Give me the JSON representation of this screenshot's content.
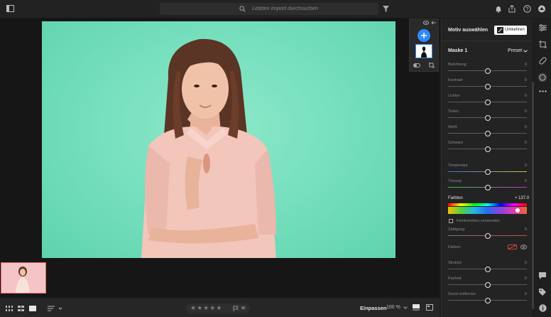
{
  "search": {
    "placeholder": "Letzten Import durchsuchen"
  },
  "rating": {
    "stars": 0,
    "max": 5
  },
  "bottom": {
    "fit_label": "Einpassen",
    "zoom_label": "100 %"
  },
  "panel": {
    "motif_label": "Motiv auswählen",
    "invert_label": "Umkehren",
    "mask_title": "Maske 1",
    "preset_label": "Preset",
    "sliders_top": [
      {
        "label": "Belichtung",
        "value": "0",
        "pos": 0.5
      },
      {
        "label": "Kontrast",
        "value": "0",
        "pos": 0.5
      },
      {
        "label": "Lichter",
        "value": "0",
        "pos": 0.5
      },
      {
        "label": "Tiefen",
        "value": "0",
        "pos": 0.5
      },
      {
        "label": "Weiß",
        "value": "0",
        "pos": 0.5
      },
      {
        "label": "Schwarz",
        "value": "0",
        "pos": 0.5
      }
    ],
    "sliders_color": [
      {
        "label": "Temperatur",
        "value": "0",
        "pos": 0.5
      },
      {
        "label": "Tönung",
        "value": "0",
        "pos": 0.5
      }
    ],
    "hue": {
      "label": "Farbton",
      "value": "+ 137.0",
      "pos": 0.88
    },
    "fine_label": "Feinkorrektur verwenden",
    "saturation": {
      "label": "Sättigung",
      "value": "0",
      "pos": 0.5
    },
    "colors_label": "Färben",
    "sliders_bottom": [
      {
        "label": "Struktur",
        "value": "0",
        "pos": 0.5
      },
      {
        "label": "Klarheit",
        "value": "0",
        "pos": 0.5
      },
      {
        "label": "Dunst entfernen",
        "value": "0",
        "pos": 0.5
      }
    ]
  },
  "colors": {
    "accent": "#2e8bff",
    "background": "#1c1c1c",
    "panel": "#232323",
    "photo_bg": "#72dcbc"
  },
  "icons": [
    "panel-toggle-icon",
    "search-icon",
    "filter-icon",
    "bell-icon",
    "share-icon",
    "help-icon",
    "cloud-icon",
    "eye-icon",
    "arrow-left-icon",
    "plus-icon",
    "toggle-icon",
    "crop-icon",
    "grid-icon",
    "square-grid-icon",
    "single-view-icon",
    "sort-icon",
    "flag-icon",
    "compare-icon",
    "info-icon",
    "edit-sliders-icon",
    "crop-tool-icon",
    "healing-icon",
    "masking-icon",
    "more-icon",
    "comment-icon",
    "tag-icon"
  ]
}
